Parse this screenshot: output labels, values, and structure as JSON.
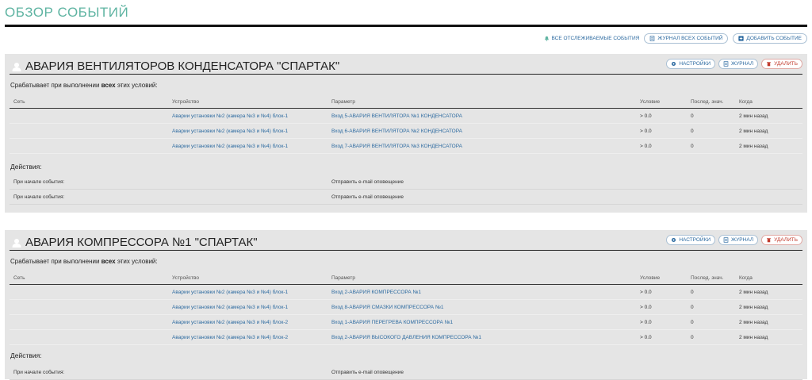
{
  "page": {
    "title": "ОБЗОР СОБЫТИЙ"
  },
  "toolbar": {
    "all_tracked_label": "ВСЕ ОТСЛЕЖИВАЕМЫЕ СОБЫТИЯ",
    "journal_all_label": "ЖУРНАЛ ВСЕХ СОБЫТИЙ",
    "add_event_label": "ДОБАВИТЬ СОБЫТИЕ"
  },
  "events": [
    {
      "title": "АВАРИЯ ВЕНТИЛЯТОРОВ КОНДЕНСАТОРА \"СПАРТАК\"",
      "settings_label": "НАСТРОЙКИ",
      "journal_label": "ЖУРНАЛ",
      "delete_label": "УДАЛИТЬ",
      "cond_prefix": "Срабатывает при выполнении ",
      "cond_bold": "всех",
      "cond_suffix": " этих условий:",
      "columns": [
        "Сеть",
        "Устройство",
        "Параметр",
        "Условие",
        "Послед. знач.",
        "Когда"
      ],
      "rows": [
        [
          "",
          "Аварии установки №2 (камера №3 и №4) блок-1",
          "Вход 5-АВАРИЯ ВЕНТИЛЯТОРА №1 КОНДЕНСАТОРА",
          "> 0.0",
          "0",
          "2 мин назад"
        ],
        [
          "",
          "Аварии установки №2 (камера №3 и №4) блок-1",
          "Вход 6-АВАРИЯ ВЕНТИЛЯТОРА №2 КОНДЕНСАТОРА",
          "> 0.0",
          "0",
          "2 мин назад"
        ],
        [
          "",
          "Аварии установки №2 (камера №3 и №4) блок-1",
          "Вход 7-АВАРИЯ ВЕНТИЛЯТОРА №3 КОНДЕНСАТОРА",
          "> 0.0",
          "0",
          "2 мин назад"
        ]
      ],
      "actions_title": "Действия:",
      "actions": [
        [
          "При начале события:",
          "Отправить e-mail оповещение"
        ],
        [
          "При начале события:",
          "Отправить e-mail оповещение"
        ]
      ]
    },
    {
      "title": "АВАРИЯ КОМПРЕССОРА №1 \"СПАРТАК\"",
      "settings_label": "НАСТРОЙКИ",
      "journal_label": "ЖУРНАЛ",
      "delete_label": "УДАЛИТЬ",
      "cond_prefix": "Срабатывает при выполнении ",
      "cond_bold": "всех",
      "cond_suffix": " этих условий:",
      "columns": [
        "Сеть",
        "Устройство",
        "Параметр",
        "Условие",
        "Послед. знач.",
        "Когда"
      ],
      "rows": [
        [
          "",
          "Аварии установки №2 (камера №3 и №4) блок-1",
          "Вход 2-АВАРИЯ КОМПРЕССОРА №1",
          "> 0.0",
          "0",
          "2 мин назад"
        ],
        [
          "",
          "Аварии установки №2 (камера №3 и №4) блок-1",
          "Вход 8-АВАРИЯ СМАЗКИ КОМПРЕССОРА №1",
          "> 0.0",
          "0",
          "2 мин назад"
        ],
        [
          "",
          "Аварии установки №2 (камера №3 и №4) блок-2",
          "Вход 1-АВАРИЯ ПЕРЕГРЕВА КОМПРЕССОРА №1",
          "> 0.0",
          "0",
          "2 мин назад"
        ],
        [
          "",
          "Аварии установки №2 (камера №3 и №4) блок-2",
          "Вход 2-АВАРИЯ ВЫСОКОГО ДАВЛЕНИЯ КОМПРЕССОРА №1",
          "> 0.0",
          "0",
          "2 мин назад"
        ]
      ],
      "actions_title": "Действия:",
      "actions": [
        [
          "При начале события:",
          "Отправить e-mail оповещение"
        ]
      ]
    }
  ],
  "colors": {
    "accent": "#5fb4a2",
    "link": "#2c6aa0",
    "danger": "#c0392b",
    "panel": "#e5e5e5"
  }
}
